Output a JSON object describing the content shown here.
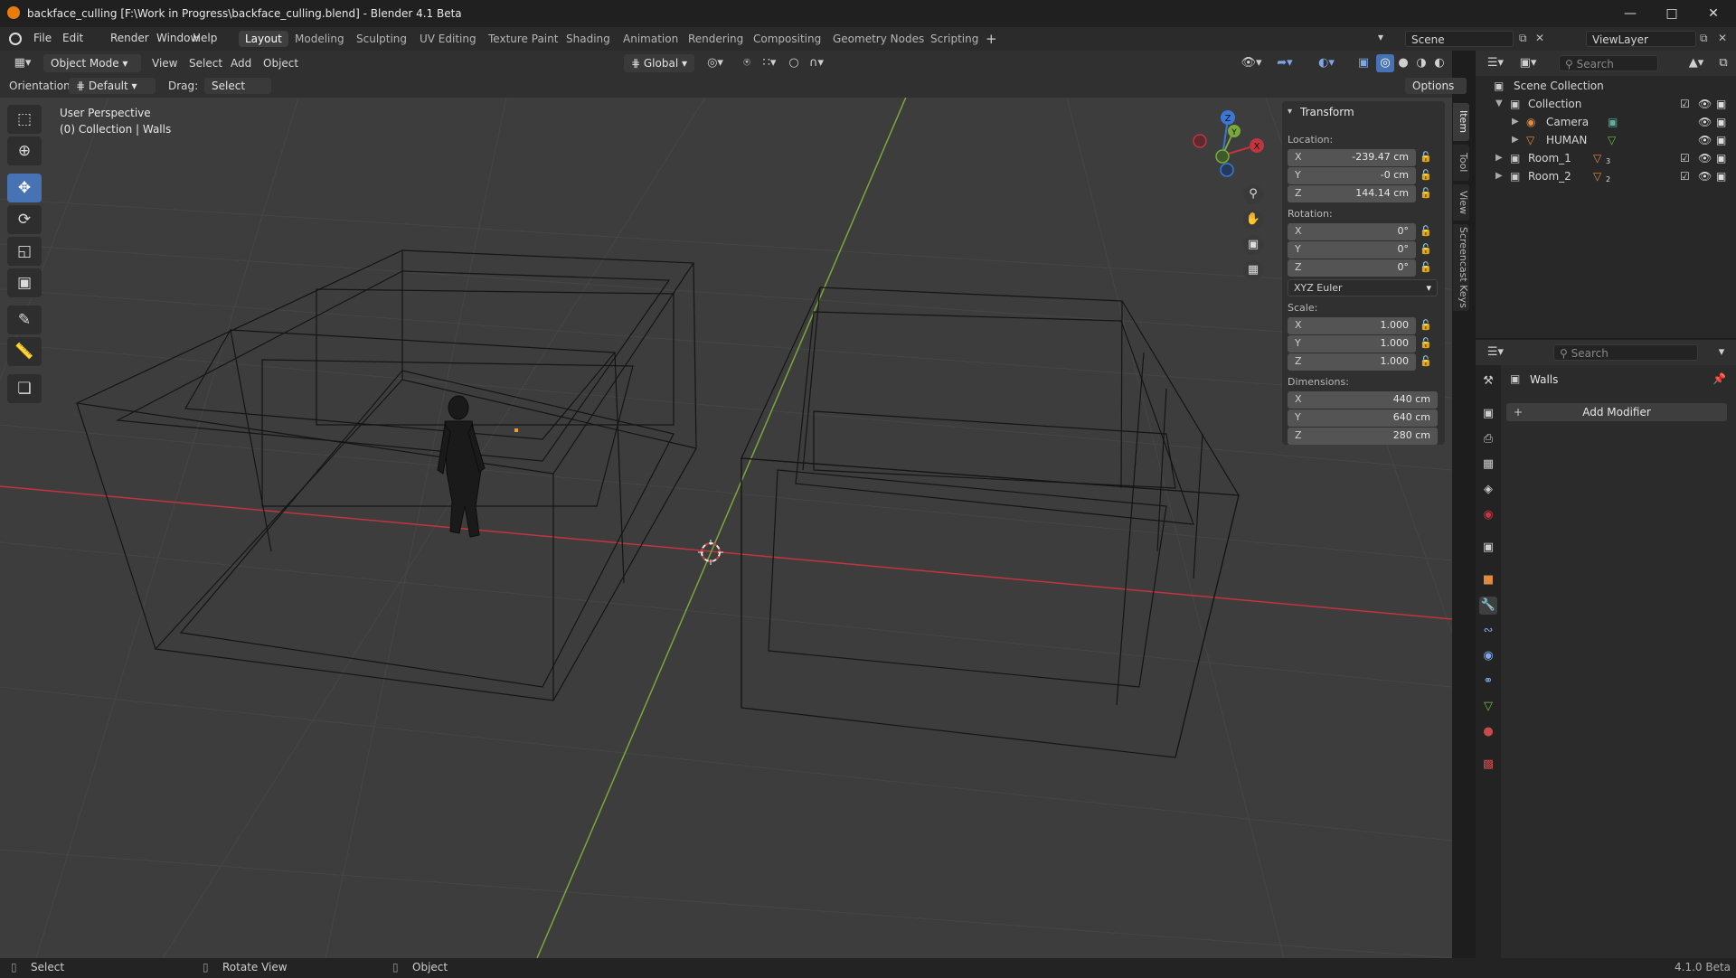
{
  "window": {
    "title": "backface_culling [F:\\Work in Progress\\backface_culling.blend] - Blender 4.1 Beta"
  },
  "menu": [
    "File",
    "Edit",
    "Render",
    "Window",
    "Help"
  ],
  "workspaces": [
    "Layout",
    "Modeling",
    "Sculpting",
    "UV Editing",
    "Texture Paint",
    "Shading",
    "Animation",
    "Rendering",
    "Compositing",
    "Geometry Nodes",
    "Scripting"
  ],
  "active_workspace": "Layout",
  "scene": {
    "name": "Scene",
    "view_layer": "ViewLayer"
  },
  "viewport_header": {
    "mode": "Object Mode",
    "menus": [
      "View",
      "Select",
      "Add",
      "Object"
    ],
    "transform_orientation": "Global"
  },
  "tool_header": {
    "orientation_label": "Orientation:",
    "orientation_value": "Default",
    "drag_label": "Drag:",
    "drag_value": "Select Box",
    "options": "Options"
  },
  "viewport": {
    "perspective": "User Perspective",
    "collection_info": "(0) Collection | Walls"
  },
  "gizmo": {
    "x": "X",
    "y": "Y",
    "z": "Z"
  },
  "npanel": {
    "title": "Transform",
    "location_label": "Location:",
    "location": {
      "x": "-239.47 cm",
      "y": "-0 cm",
      "z": "144.14 cm"
    },
    "rotation_label": "Rotation:",
    "rotation": {
      "x": "0°",
      "y": "0°",
      "z": "0°"
    },
    "rotation_mode": "XYZ Euler",
    "scale_label": "Scale:",
    "scale": {
      "x": "1.000",
      "y": "1.000",
      "z": "1.000"
    },
    "dimensions_label": "Dimensions:",
    "dimensions": {
      "x": "440 cm",
      "y": "640 cm",
      "z": "280 cm"
    },
    "axes": {
      "x": "X",
      "y": "Y",
      "z": "Z"
    },
    "tabs": [
      "Item",
      "Tool",
      "View",
      "Screencast Keys"
    ]
  },
  "outliner": {
    "search_placeholder": "Search",
    "rows": [
      {
        "label": "Scene Collection"
      },
      {
        "label": "Collection"
      },
      {
        "label": "Camera"
      },
      {
        "label": "HUMAN"
      },
      {
        "label": "Room_1",
        "badge": "3"
      },
      {
        "label": "Room_2",
        "badge": "2"
      }
    ]
  },
  "properties": {
    "search_placeholder": "Search",
    "object_name": "Walls",
    "add_modifier": "Add Modifier"
  },
  "statusbar": {
    "select": "Select",
    "rotate": "Rotate View",
    "object": "Object",
    "version": "4.1.0 Beta"
  },
  "colors": {
    "accent": "#4772b3",
    "x_axis": "#c2343f",
    "y_axis": "#7aa83a",
    "z_axis": "#3a78d6",
    "grid": "#464646"
  }
}
